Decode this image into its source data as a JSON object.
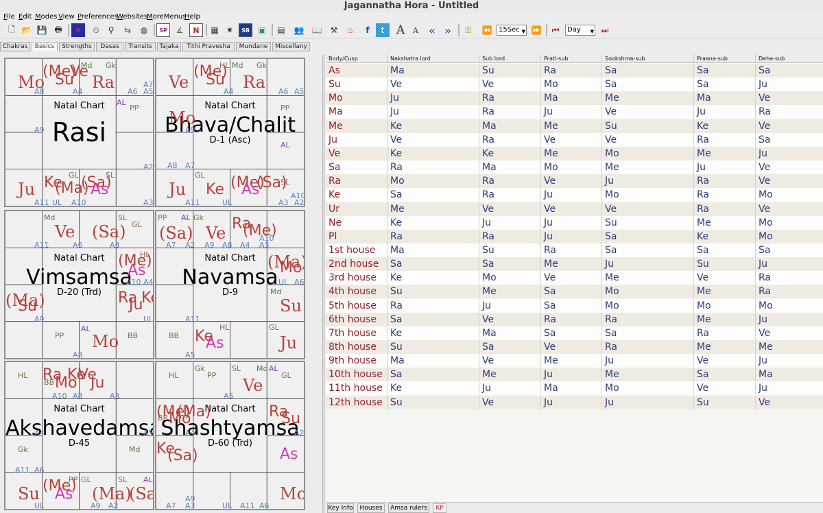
{
  "window": {
    "title": "Jagannatha Hora - Untitled"
  },
  "menu": [
    "File",
    "Edit",
    "Modes",
    "View",
    "Preferences",
    "Websites",
    "MoreMenus",
    "Help"
  ],
  "toolbar": {
    "period_value": "15Sec",
    "unit_value": "Day"
  },
  "tabs": [
    "Chakras",
    "Basics",
    "Strengths",
    "Dasas",
    "Transits",
    "Tajaka",
    "Tithi Pravesha",
    "Mundane",
    "Miscellany"
  ],
  "charts": [
    {
      "title": "Natal Chart",
      "name": "Rasi",
      "sub": ""
    },
    {
      "title": "Natal Chart",
      "name": "Bhava/Chalit",
      "sub": "D-1 (Asc)"
    },
    {
      "title": "Natal Chart",
      "name": "Vimsamsa",
      "sub": "D-20 (Trd)"
    },
    {
      "title": "Natal Chart",
      "name": "Navamsa",
      "sub": "D-9"
    },
    {
      "title": "Natal Chart",
      "name": "Akshavedamsa",
      "sub": "D-45"
    },
    {
      "title": "Natal Chart",
      "name": "Shashtyamsa",
      "sub": "D-60 (Trd)"
    }
  ],
  "table": {
    "headers": [
      "Body/Cusp",
      "Nakshatra lord",
      "Sub lord",
      "Prati-sub",
      "Sookshma-sub",
      "Praana-sub",
      "Deha-sub"
    ],
    "rows": [
      [
        "As",
        "Ma",
        "Su",
        "Ra",
        "Sa",
        "Sa",
        "Sa"
      ],
      [
        "Su",
        "Ve",
        "Ve",
        "Mo",
        "Sa",
        "Sa",
        "Ju"
      ],
      [
        "Mo",
        "Ju",
        "Ra",
        "Ma",
        "Me",
        "Ma",
        "Ve"
      ],
      [
        "Ma",
        "Ju",
        "Ra",
        "Ju",
        "Ve",
        "Ju",
        "Ra"
      ],
      [
        "Me",
        "Ke",
        "Ma",
        "Me",
        "Su",
        "Ke",
        "Ve"
      ],
      [
        "Ju",
        "Ve",
        "Ra",
        "Ve",
        "Ve",
        "Ra",
        "Sa"
      ],
      [
        "Ve",
        "Ke",
        "Ke",
        "Me",
        "Mo",
        "Me",
        "Ju"
      ],
      [
        "Sa",
        "Ra",
        "Ma",
        "Mo",
        "Me",
        "Ju",
        "Ve"
      ],
      [
        "Ra",
        "Mo",
        "Ra",
        "Ve",
        "Ju",
        "Ra",
        "Ve"
      ],
      [
        "Ke",
        "Sa",
        "Ra",
        "Ju",
        "Mo",
        "Ra",
        "Mo"
      ],
      [
        "Ur",
        "Me",
        "Ve",
        "Ve",
        "Ve",
        "Ra",
        "Ve"
      ],
      [
        "Ne",
        "Ke",
        "Ju",
        "Ju",
        "Su",
        "Me",
        "Mo"
      ],
      [
        "Pl",
        "Ra",
        "Ra",
        "Ju",
        "Sa",
        "Ke",
        "Mo"
      ],
      [
        "1st house",
        "Ma",
        "Su",
        "Ra",
        "Sa",
        "Sa",
        "Sa"
      ],
      [
        "2nd house",
        "Sa",
        "Sa",
        "Me",
        "Ju",
        "Su",
        "Ju"
      ],
      [
        "3rd house",
        "Ke",
        "Mo",
        "Ve",
        "Me",
        "Ve",
        "Ra"
      ],
      [
        "4th house",
        "Su",
        "Me",
        "Sa",
        "Mo",
        "Me",
        "Ra"
      ],
      [
        "5th house",
        "Ra",
        "Ju",
        "Sa",
        "Mo",
        "Mo",
        "Mo"
      ],
      [
        "6th house",
        "Sa",
        "Ve",
        "Ra",
        "Ra",
        "Me",
        "Ju"
      ],
      [
        "7th house",
        "Ke",
        "Ma",
        "Sa",
        "Sa",
        "Ra",
        "Ve"
      ],
      [
        "8th house",
        "Su",
        "Sa",
        "Ve",
        "Ra",
        "Me",
        "Me"
      ],
      [
        "9th house",
        "Ma",
        "Ve",
        "Me",
        "Ju",
        "Ve",
        "Ju"
      ],
      [
        "10th house",
        "Sa",
        "Me",
        "Ju",
        "Me",
        "Sa",
        "Ma"
      ],
      [
        "11th house",
        "Ke",
        "Ju",
        "Ma",
        "Mo",
        "Ve",
        "Ju"
      ],
      [
        "12th house",
        "Su",
        "Ve",
        "Ju",
        "Ju",
        "Su",
        "Ve"
      ]
    ]
  },
  "bottom_tabs": [
    "Key Info",
    "Houses",
    "Amsa rulers",
    "KP"
  ]
}
